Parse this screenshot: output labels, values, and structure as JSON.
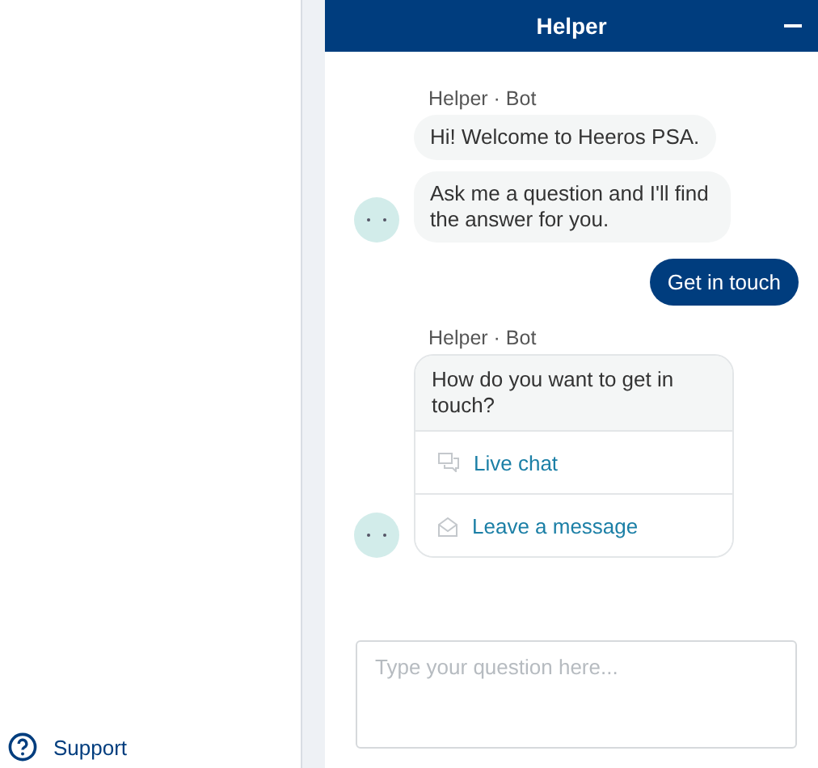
{
  "sidebar": {
    "support_link": "Support"
  },
  "chat": {
    "title": "Helper",
    "messages": [
      {
        "kind": "bot",
        "sender": "Helper · Bot",
        "bubbles": [
          "Hi! Welcome to Heeros PSA.",
          "Ask me a question and I'll find the answer for you."
        ]
      },
      {
        "kind": "user",
        "text": "Get in touch"
      },
      {
        "kind": "options",
        "sender": "Helper · Bot",
        "question": "How do you want to get in touch?",
        "options": [
          {
            "kind": "chat",
            "label": "Live chat"
          },
          {
            "kind": "mail",
            "label": "Leave a message"
          }
        ]
      }
    ],
    "input": {
      "placeholder": "Type your question here..."
    }
  }
}
